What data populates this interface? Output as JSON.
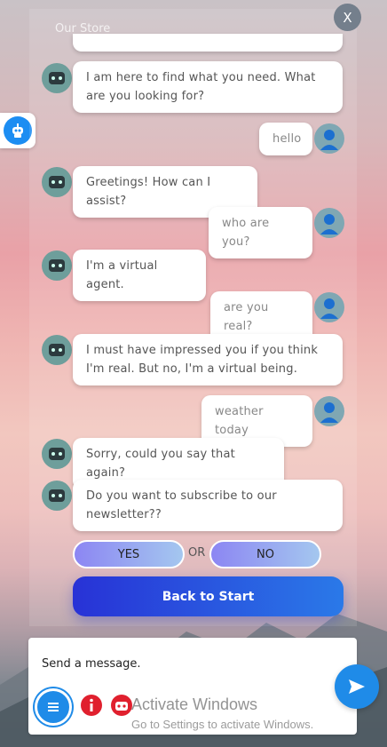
{
  "header": {
    "title": "Our Store",
    "close_label": "X"
  },
  "messages": [
    {
      "from": "bot",
      "text": "I am here to find what you need. What are you looking for?"
    },
    {
      "from": "user",
      "text": "hello"
    },
    {
      "from": "bot",
      "text": "Greetings! How can I assist?"
    },
    {
      "from": "user",
      "text": "who are you?"
    },
    {
      "from": "bot",
      "text": "I'm a virtual agent."
    },
    {
      "from": "user",
      "text": "are you real?"
    },
    {
      "from": "bot",
      "text": "I must have impressed you if you think I'm real. But no, I'm a virtual being."
    },
    {
      "from": "user",
      "text": "weather today"
    },
    {
      "from": "bot",
      "text": "Sorry, could you say that again?"
    },
    {
      "from": "bot",
      "text": "Do you want to subscribe to our newsletter??"
    }
  ],
  "quick_replies": {
    "yes": "YES",
    "or": "OR",
    "no": "NO"
  },
  "back_button": "Back to Start",
  "input": {
    "text": "Send a message."
  },
  "icons": {
    "menu": "menu-icon",
    "info": "info-icon",
    "bot": "bot-icon",
    "send": "send-icon",
    "launcher": "robot-icon"
  },
  "watermark": {
    "line1": "Activate Windows",
    "line2": "Go to Settings to activate Windows."
  },
  "colors": {
    "accent": "#1f8be8",
    "back_button_start": "#2832d6",
    "back_button_end": "#2a79e8",
    "info": "#e0202e"
  }
}
